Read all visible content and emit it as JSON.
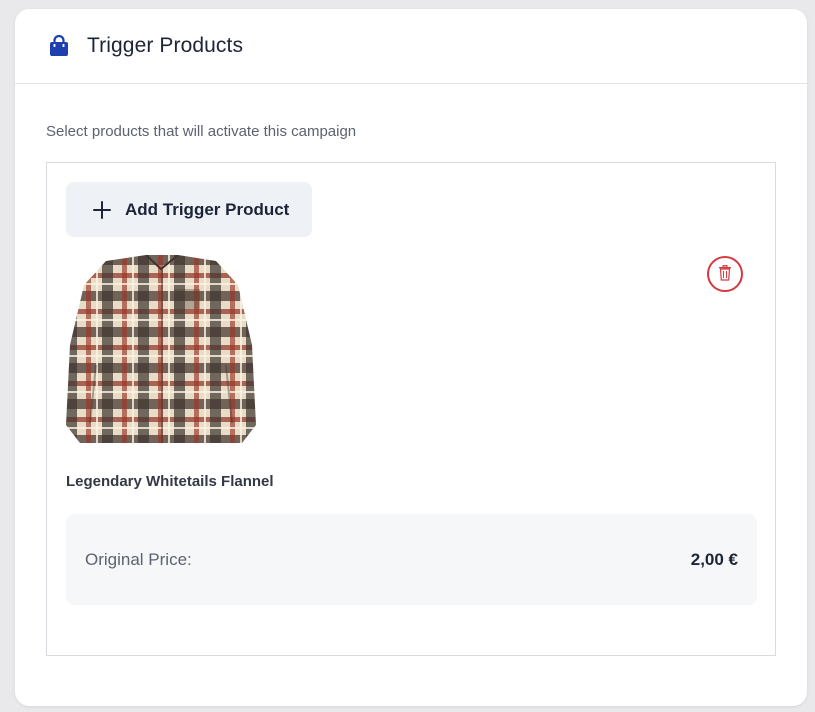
{
  "card": {
    "title": "Trigger Products",
    "icon": "shopping-bag-icon"
  },
  "subtitle": "Select products that will activate this campaign",
  "add_button": {
    "label": "Add Trigger Product",
    "icon": "plus-icon"
  },
  "product": {
    "name": "Legendary Whitetails Flannel",
    "image": "plaid-flannel-shirt-image",
    "delete_icon": "trash-icon",
    "price_label": "Original Price:",
    "price_value": "2,00 €"
  },
  "colors": {
    "brand_icon": "#1e40af",
    "danger": "#d43a3f",
    "text_dark": "#1c2537",
    "text_muted": "#5c6270",
    "button_bg": "#eef1f6",
    "price_bg": "#f6f7f9"
  }
}
